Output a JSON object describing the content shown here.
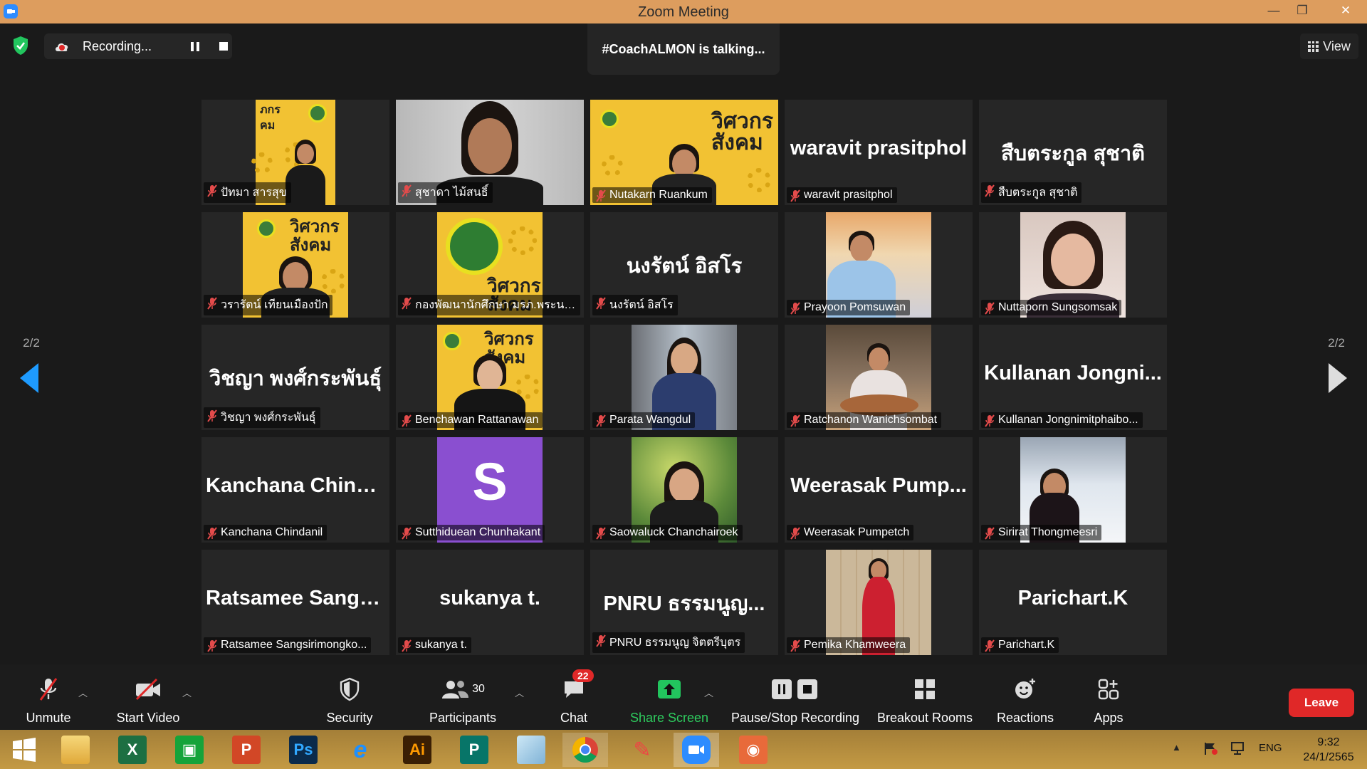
{
  "window": {
    "title": "Zoom Meeting",
    "minimize": "—",
    "maximize": "❐",
    "close": "✕"
  },
  "recording": {
    "label": "Recording..."
  },
  "talking": "#CoachALMON is talking...",
  "view": {
    "label": "View"
  },
  "pager": {
    "left": "2/2",
    "right": "2/2"
  },
  "participants": [
    {
      "name": "ปัทมา สารสุข",
      "tile": "poster",
      "big": ""
    },
    {
      "name": "สุชาดา ไม้สนธิ์",
      "tile": "camera",
      "big": ""
    },
    {
      "name": "Nutakarn Ruankum",
      "tile": "poster-wide",
      "big": ""
    },
    {
      "name": "waravit prasitphol",
      "tile": "text",
      "big": "waravit prasitphol"
    },
    {
      "name": "สืบตระกูล สุชาติ",
      "tile": "text",
      "big": "สืบตระกูล สุชาติ"
    },
    {
      "name": "วรารัตน์ เทียนเมืองปัก",
      "tile": "poster",
      "big": ""
    },
    {
      "name": "กองพัฒนานักศึกษา มรภ.พระนคร",
      "tile": "poster-logo",
      "big": ""
    },
    {
      "name": "นงรัตน์ อิสโร",
      "tile": "text",
      "big": "นงรัตน์ อิสโร"
    },
    {
      "name": "Prayoon Pomsuwan",
      "tile": "photo-speaker",
      "big": ""
    },
    {
      "name": "Nuttaporn Sungsomsak",
      "tile": "photo-selfie",
      "big": ""
    },
    {
      "name": "วิชญา พงศ์กระพันธุ์",
      "tile": "text",
      "big": "วิชญา พงศ์กระพันธุ์"
    },
    {
      "name": "Benchawan Rattanawan",
      "tile": "poster-suit",
      "big": ""
    },
    {
      "name": "Parata Wangdul",
      "tile": "photo-office",
      "big": ""
    },
    {
      "name": "Ratchanon Wanichsombat",
      "tile": "photo-cook",
      "big": ""
    },
    {
      "name": "Kullanan Jongnimitphaibo...",
      "tile": "text",
      "big": "Kullanan  Jongni..."
    },
    {
      "name": "Kanchana Chindanil",
      "tile": "text",
      "big": "Kanchana  Chind..."
    },
    {
      "name": "Sutthiduean Chunhakant",
      "tile": "avatar",
      "big": "S"
    },
    {
      "name": "Saowaluck Chanchairoek",
      "tile": "photo-garden",
      "big": ""
    },
    {
      "name": "Weerasak Pumpetch",
      "tile": "text",
      "big": "Weerasak  Pump..."
    },
    {
      "name": "Sirirat Thongmeesri",
      "tile": "photo-snow",
      "big": ""
    },
    {
      "name": "Ratsamee Sangsirimongko...",
      "tile": "text",
      "big": "Ratsamee  Sangs..."
    },
    {
      "name": "sukanya t.",
      "tile": "text",
      "big": "sukanya t."
    },
    {
      "name": "PNRU ธรรมนูญ จิตตรีบุตร",
      "tile": "text",
      "big": "PNRU  ธรรมนูญ..."
    },
    {
      "name": "Pemika Khamweera",
      "tile": "photo-dress",
      "big": ""
    },
    {
      "name": "Parichart.K",
      "tile": "text",
      "big": "Parichart.K"
    }
  ],
  "toolbar": {
    "unmute": "Unmute",
    "start_video": "Start Video",
    "security": "Security",
    "participants": "Participants",
    "participants_count": "30",
    "chat": "Chat",
    "chat_badge": "22",
    "share_screen": "Share Screen",
    "pause_stop": "Pause/Stop Recording",
    "breakout": "Breakout Rooms",
    "reactions": "Reactions",
    "apps": "Apps",
    "leave": "Leave"
  },
  "taskbar": {
    "apps": [
      "start",
      "file-explorer",
      "excel",
      "store",
      "powerpoint",
      "photoshop",
      "internet-explorer",
      "illustrator",
      "publisher",
      "notepad",
      "chrome",
      "paint",
      "zoom",
      "camera"
    ],
    "lang": "ENG",
    "time": "9:32",
    "date": "24/1/2565"
  },
  "colors": {
    "accent": "#2d8cff",
    "leave": "#e02828",
    "share": "#2ecc5e",
    "poster": "#f2c233",
    "avatar": "#8a4fd0"
  }
}
